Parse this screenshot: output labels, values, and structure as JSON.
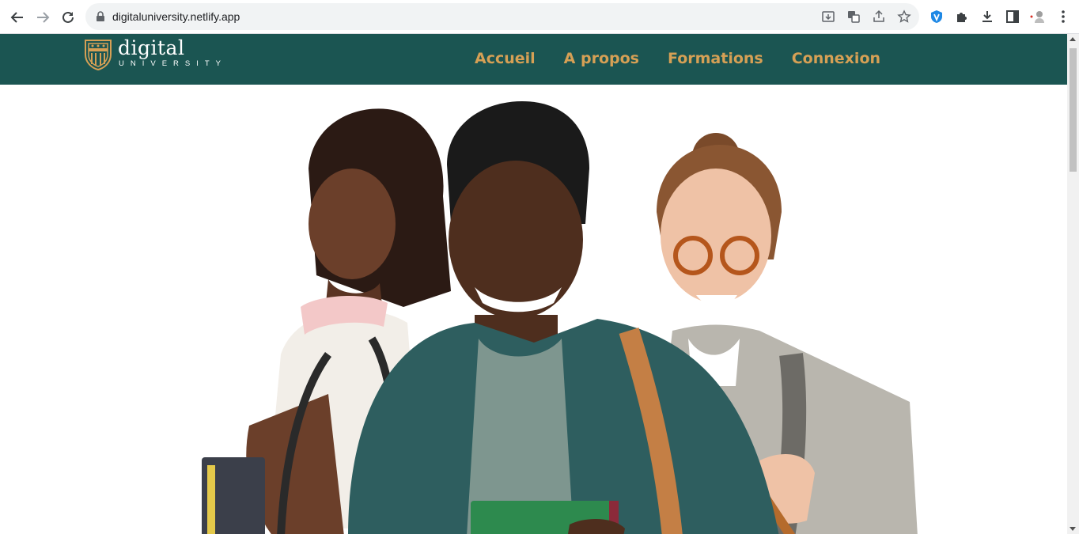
{
  "browser": {
    "url": "digitaluniversity.netlify.app",
    "icons": {
      "back": "arrow-left-icon",
      "forward": "arrow-right-icon",
      "reload": "reload-icon",
      "lock": "lock-icon",
      "install": "install-app-icon",
      "translate": "translate-icon",
      "share": "share-icon",
      "bookmark": "star-icon",
      "extension_shield": "shield-extension-icon",
      "extensions": "puzzle-icon",
      "downloads": "download-icon",
      "side_panel": "side-panel-icon",
      "profile": "profile-avatar-icon",
      "menu": "kebab-menu-icon"
    }
  },
  "site": {
    "colors": {
      "header_bg": "#1b5552",
      "accent": "#d6a055",
      "logo_text": "#ffffff"
    },
    "logo": {
      "word": "digital",
      "sub": "UNIVERSITY"
    },
    "nav": [
      {
        "label": "Accueil"
      },
      {
        "label": "A propos"
      },
      {
        "label": "Formations"
      },
      {
        "label": "Connexion"
      }
    ]
  },
  "hero": {
    "image": "three-students-smiling-photo"
  }
}
